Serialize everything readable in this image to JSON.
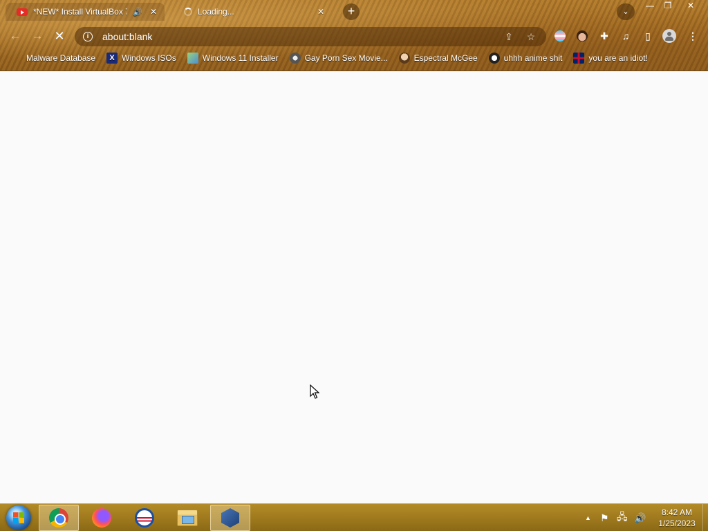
{
  "window": {
    "tabs": [
      {
        "title": "*NEW* Install VirtualBox 7",
        "favicon": "youtube-icon",
        "audio": true,
        "close": "✕"
      },
      {
        "title": "Loading...",
        "favicon": "loading-spinner-icon",
        "close": "✕"
      }
    ],
    "new_tab": "+",
    "tab_search": "⌄",
    "controls": {
      "minimize": "—",
      "maximize": "❐",
      "close": "✕"
    }
  },
  "toolbar": {
    "back": "←",
    "forward": "→",
    "stop": "✕",
    "url": "about:blank",
    "share_icon": "⇪",
    "bookmark_star": "☆",
    "puzzle": "✚",
    "media": "♫",
    "side_panel": "▯",
    "menu": "⋮"
  },
  "bookmarks": [
    {
      "label": "Malware Database",
      "icon": "blank"
    },
    {
      "label": "Windows ISOs",
      "icon": "x",
      "glyph": "X"
    },
    {
      "label": "Windows 11 Installer",
      "icon": "img"
    },
    {
      "label": "Gay Porn Sex Movie...",
      "icon": "disc"
    },
    {
      "label": "Espectral McGee",
      "icon": "char"
    },
    {
      "label": "uhhh anime shit",
      "icon": "anime"
    },
    {
      "label": "you are an idiot!",
      "icon": "uk"
    }
  ],
  "taskbar": {
    "apps": [
      "chrome",
      "firefox",
      "obama",
      "explorer",
      "virtualbox"
    ],
    "tray": {
      "arrow": "▲",
      "flag": "⚑",
      "network": "🖧",
      "volume": "🔊"
    },
    "clock": {
      "time": "8:42 AM",
      "date": "1/25/2023"
    }
  }
}
